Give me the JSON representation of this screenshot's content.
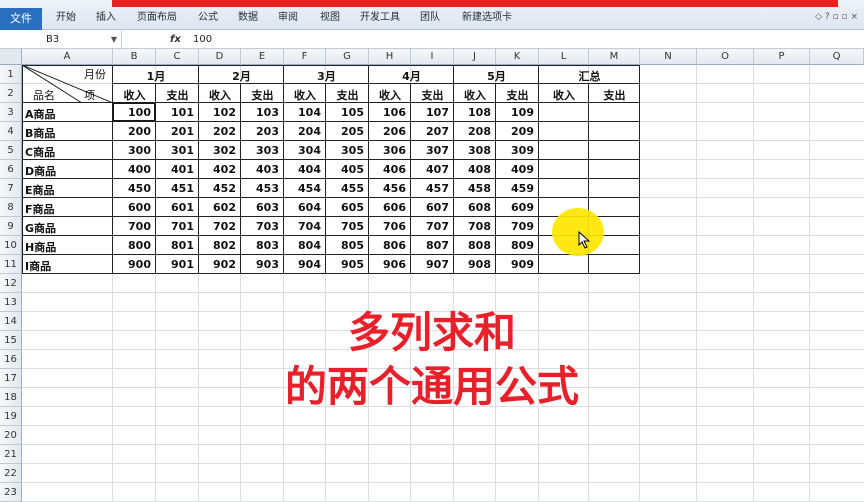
{
  "ribbon": {
    "file_tab": "文件",
    "tabs": [
      "开始",
      "插入",
      "页面布局",
      "公式",
      "数据",
      "审阅",
      "视图",
      "开发工具",
      "团队",
      "新建选项卡"
    ]
  },
  "formula_bar": {
    "cell_ref": "B3",
    "fx": "fx",
    "value": "100"
  },
  "columns": [
    "A",
    "B",
    "C",
    "D",
    "E",
    "F",
    "G",
    "H",
    "I",
    "J",
    "K",
    "L",
    "M",
    "N",
    "O",
    "P",
    "Q"
  ],
  "rows": [
    "1",
    "2",
    "3",
    "4",
    "5",
    "6",
    "7",
    "8",
    "9",
    "10",
    "11",
    "12",
    "13",
    "14",
    "15",
    "16",
    "17",
    "18",
    "19",
    "20",
    "21",
    "22",
    "23"
  ],
  "table": {
    "diag_top": "月份",
    "diag_bottom_left": "品名",
    "diag_bottom_right": "项",
    "months": [
      "1月",
      "2月",
      "3月",
      "4月",
      "5月"
    ],
    "summary": "汇总",
    "income": "收入",
    "expense": "支出",
    "products": [
      {
        "name": "A商品",
        "values": [
          100,
          101,
          102,
          103,
          104,
          105,
          106,
          107,
          108,
          109
        ]
      },
      {
        "name": "B商品",
        "values": [
          200,
          201,
          202,
          203,
          204,
          205,
          206,
          207,
          208,
          209
        ]
      },
      {
        "name": "C商品",
        "values": [
          300,
          301,
          302,
          303,
          304,
          305,
          306,
          307,
          308,
          309
        ]
      },
      {
        "name": "D商品",
        "values": [
          400,
          401,
          402,
          403,
          404,
          405,
          406,
          407,
          408,
          409
        ]
      },
      {
        "name": "E商品",
        "values": [
          450,
          451,
          452,
          453,
          454,
          455,
          456,
          457,
          458,
          459
        ]
      },
      {
        "name": "F商品",
        "values": [
          600,
          601,
          602,
          603,
          604,
          605,
          606,
          607,
          608,
          609
        ]
      },
      {
        "name": "G商品",
        "values": [
          700,
          701,
          702,
          703,
          704,
          705,
          706,
          707,
          708,
          709
        ]
      },
      {
        "name": "H商品",
        "values": [
          800,
          801,
          802,
          803,
          804,
          805,
          806,
          807,
          808,
          809
        ]
      },
      {
        "name": "I商品",
        "values": [
          900,
          901,
          902,
          903,
          904,
          905,
          906,
          907,
          908,
          909
        ]
      }
    ]
  },
  "caption": {
    "line1": "多列求和",
    "line2": "的两个通用公式"
  },
  "colors": {
    "caption": "#e8202a",
    "highlight": "#ffe600",
    "accent_bar": "#e8221e"
  }
}
